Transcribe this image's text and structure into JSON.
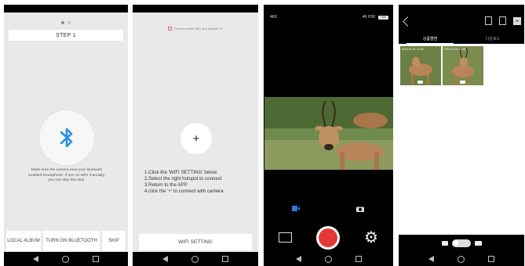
{
  "screen1": {
    "step_label": "STEP 1",
    "bluetooth_hint": "Make sure the camera near your bluetooth enabled smartphone. If turn on WiFi manually, you can skip this step.",
    "buttons": [
      "LOCAL ALBUM",
      "TURN ON BLUETOOTH",
      "SKIP"
    ],
    "bluetooth_color": "#2b8fe0"
  },
  "screen2": {
    "top_note": "Please enable WiFi and disable 4G",
    "plus_symbol": "+",
    "instructions": [
      "1.Click the 'WIFI SETTING' below",
      "2.Select the right hotspot to connect",
      "3.Return to the APP",
      "4.click the '+' to connect with camera"
    ],
    "wifi_button": "WIFI SETTING"
  },
  "screen3": {
    "top_left": "4K6",
    "top_right": "4K P30",
    "battery_label": "100",
    "gear_symbol": "⚙"
  },
  "screen4": {
    "tabs": [
      "상품앨범",
      "다운로드"
    ],
    "badge": "4K",
    "thumb_labels": [
      "2019-01-01 12:00",
      "2019-01-01 12:00"
    ]
  }
}
